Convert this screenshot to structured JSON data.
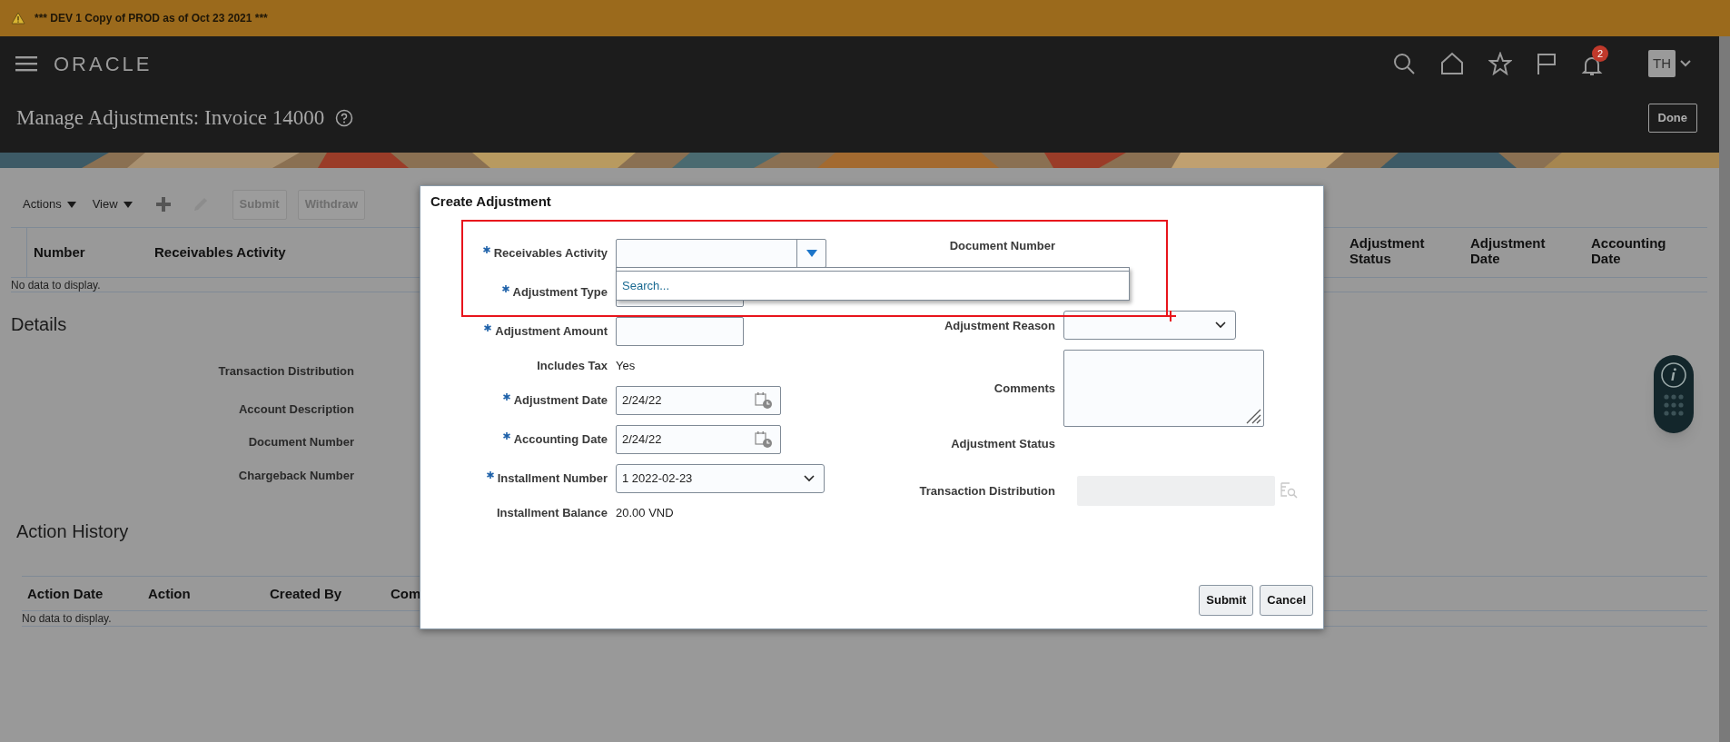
{
  "banner": {
    "text": "*** DEV 1 Copy of PROD as of Oct 23 2021 ***"
  },
  "header": {
    "logo": "ORACLE",
    "notification_count": "2",
    "avatar": "TH"
  },
  "page": {
    "title": "Manage Adjustments: Invoice 14000",
    "done_button": "Done"
  },
  "toolbar": {
    "menus": [
      "Actions",
      "View"
    ],
    "buttons": [
      {
        "label": "Submit",
        "disabled": true
      },
      {
        "label": "Withdraw",
        "disabled": true
      }
    ]
  },
  "adjustments_table": {
    "columns": [
      "Number",
      "Receivables Activity",
      "Adjustment Status",
      "Adjustment Date",
      "Accounting Date"
    ],
    "empty_text": "No data to display."
  },
  "details": {
    "title": "Details",
    "labels": [
      "Transaction Distribution",
      "Account Description",
      "Document Number",
      "Chargeback Number"
    ]
  },
  "action_history": {
    "title": "Action History",
    "columns": [
      "Action Date",
      "Action",
      "Created By",
      "Com"
    ],
    "empty_text": "No data to display."
  },
  "dialog": {
    "title": "Create Adjustment",
    "left_fields": [
      {
        "label": "Receivables Activity",
        "required": true,
        "kind": "lov"
      },
      {
        "label": "Adjustment Type",
        "required": true,
        "kind": "text"
      },
      {
        "label": "Adjustment Amount",
        "required": true,
        "kind": "text"
      },
      {
        "label": "Includes Tax",
        "required": false,
        "kind": "display",
        "value": "Yes"
      },
      {
        "label": "Adjustment Date",
        "required": true,
        "kind": "date",
        "value": "2/24/22"
      },
      {
        "label": "Accounting Date",
        "required": true,
        "kind": "date",
        "value": "2/24/22"
      },
      {
        "label": "Installment Number",
        "required": true,
        "kind": "select",
        "value": "1 2022-02-23"
      },
      {
        "label": "Installment Balance",
        "required": false,
        "kind": "display",
        "value": "20.00 VND"
      }
    ],
    "right_fields": [
      {
        "label": "Document Number",
        "required": false,
        "kind": "display"
      },
      {
        "label": "Adjustment Reason",
        "required": false,
        "kind": "select"
      },
      {
        "label": "Comments",
        "required": false,
        "kind": "textarea"
      },
      {
        "label": "Adjustment Status",
        "required": false,
        "kind": "display"
      },
      {
        "label": "Transaction Distribution",
        "required": false,
        "kind": "lookup",
        "disabled": true
      }
    ],
    "dropdown": {
      "placeholder": "Search..."
    },
    "buttons": [
      "Submit",
      "Cancel"
    ]
  }
}
